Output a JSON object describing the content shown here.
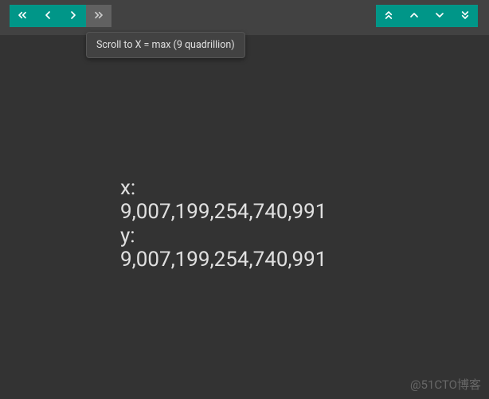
{
  "tooltip": {
    "text": "Scroll to X = max (9 quadrillion)"
  },
  "content": {
    "x_label": "x:",
    "x_value": "9,007,199,254,740,991",
    "y_label": "y:",
    "y_value": "9,007,199,254,740,991"
  },
  "watermark": "@51CTO博客",
  "icons": {
    "h_first": "chevrons-left-icon",
    "h_prev": "chevron-left-icon",
    "h_next": "chevron-right-icon",
    "h_last": "chevrons-right-icon",
    "v_first": "chevrons-up-icon",
    "v_prev": "chevron-up-icon",
    "v_next": "chevron-down-icon",
    "v_last": "chevrons-down-icon"
  }
}
